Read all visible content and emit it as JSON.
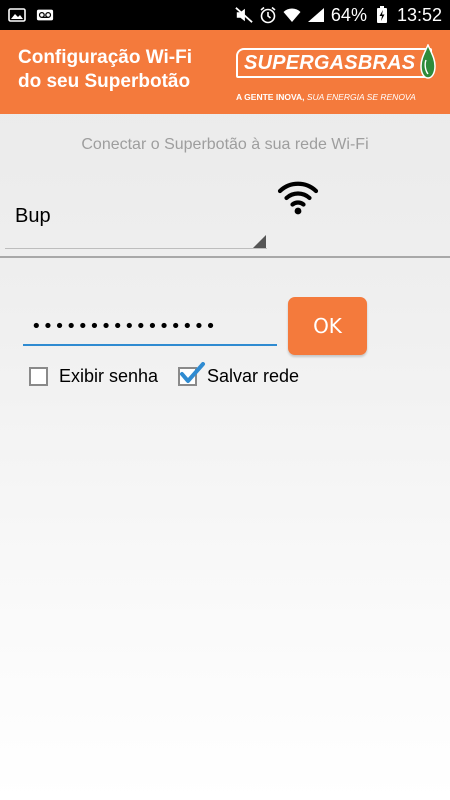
{
  "status_bar": {
    "battery": "64%",
    "time": "13:52",
    "icons": [
      "image-icon",
      "voicemail-icon",
      "mute-icon",
      "alarm-icon",
      "wifi-icon",
      "signal-icon",
      "battery-icon"
    ]
  },
  "header": {
    "title_line1": "Configuração Wi-Fi",
    "title_line2": "do seu Superbotão",
    "brand_logo_text": "SUPERGASBRAS",
    "brand_tagline_bold": "A GENTE INOVA, ",
    "brand_tagline_italic": "SUA ENERGIA SE RENOVA",
    "color": "#f47a3c"
  },
  "main": {
    "subtitle": "Conectar o Superbotão à sua rede Wi-Fi",
    "network": {
      "selected": "Bup"
    },
    "password": {
      "value": "••••••••••••••••",
      "type": "password"
    },
    "ok_label": "OK",
    "checkboxes": [
      {
        "label": "Exibir senha",
        "checked": false
      },
      {
        "label": "Salvar rede",
        "checked": true
      }
    ],
    "accent": "#2f8bd1"
  }
}
